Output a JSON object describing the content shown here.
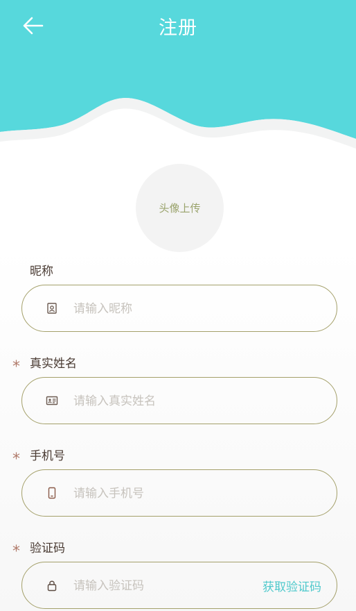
{
  "header": {
    "title": "注册",
    "back_icon": "arrow-left-icon",
    "color": "#57d8dc"
  },
  "avatar": {
    "label": "头像上传"
  },
  "form": {
    "nickname": {
      "label": "昵称",
      "placeholder": "请输入昵称",
      "icon": "user-card-icon",
      "required": false
    },
    "real_name": {
      "label": "真实姓名",
      "placeholder": "请输入真实姓名",
      "icon": "id-card-icon",
      "required": true
    },
    "phone": {
      "label": "手机号",
      "placeholder": "请输入手机号",
      "icon": "phone-icon",
      "required": true
    },
    "code": {
      "label": "验证码",
      "placeholder": "请输入验证码",
      "icon": "lock-icon",
      "required": true,
      "action_label": "获取验证码"
    }
  },
  "required_mark": "*",
  "colors": {
    "accent": "#57d8dc",
    "border": "#a4a06a",
    "star": "#b07a6a",
    "label": "#4a3b33"
  }
}
